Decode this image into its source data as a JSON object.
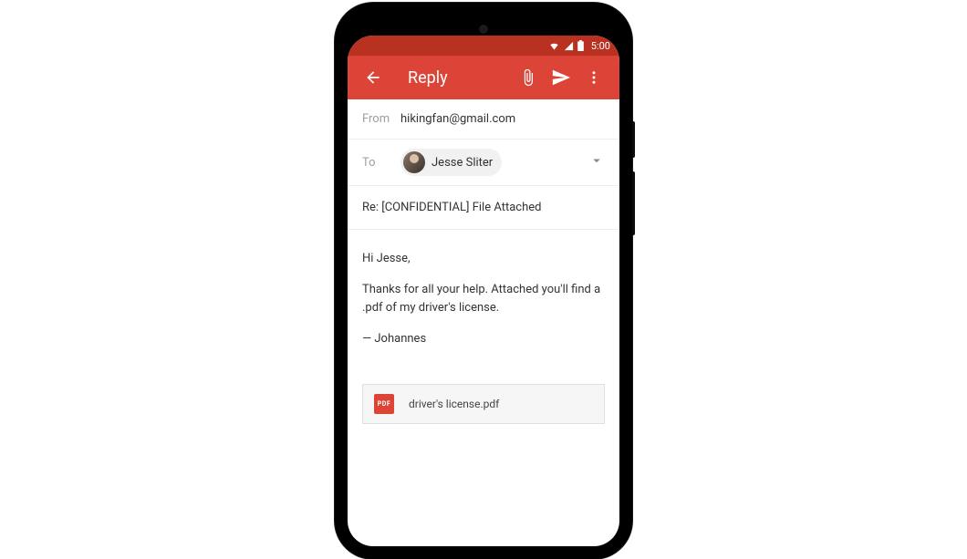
{
  "status": {
    "time": "5:00"
  },
  "appbar": {
    "title": "Reply"
  },
  "compose": {
    "from_label": "From",
    "from_value": "hikingfan@gmail.com",
    "to_label": "To",
    "to_chip_name": "Jesse Sliter",
    "subject": "Re: [CONFIDENTIAL] File Attached",
    "body_greeting": "Hi Jesse,",
    "body_main": "Thanks for all your help. Attached you'll find a .pdf of my driver's license.",
    "body_signoff": "— Johannes"
  },
  "attachment": {
    "badge": "PDF",
    "filename": "driver's license.pdf"
  }
}
